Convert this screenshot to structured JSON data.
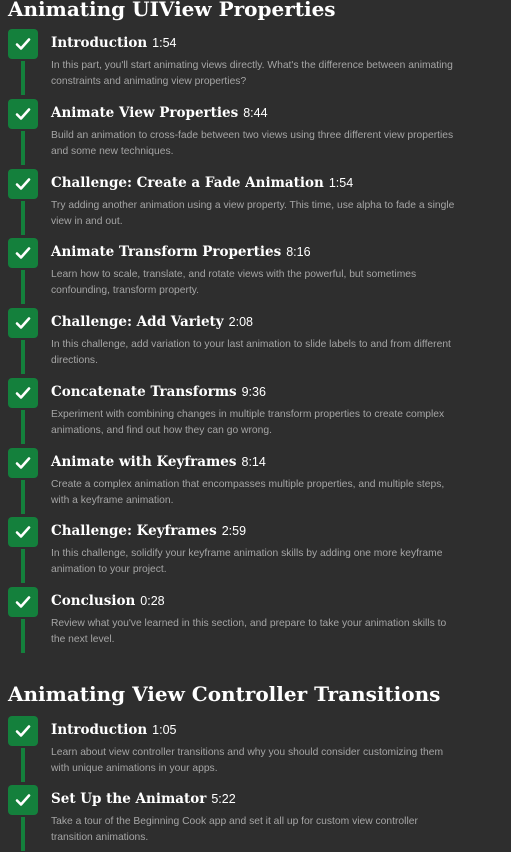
{
  "sections": [
    {
      "title": "Animating UIView Properties",
      "lessons": [
        {
          "title": "Introduction",
          "duration": "1:54",
          "description": "In this part, you'll start animating views directly. What's the difference between animating constraints and animating view properties?",
          "completed": true
        },
        {
          "title": "Animate View Properties",
          "duration": "8:44",
          "description": "Build an animation to cross-fade between two views using three different view properties and some new techniques.",
          "completed": true
        },
        {
          "title": "Challenge: Create a Fade Animation",
          "duration": "1:54",
          "description": "Try adding another animation using a view property. This time, use alpha to fade a single view in and out.",
          "completed": true
        },
        {
          "title": "Animate Transform Properties",
          "duration": "8:16",
          "description": "Learn how to scale, translate, and rotate views with the powerful, but sometimes confounding, transform property.",
          "completed": true
        },
        {
          "title": "Challenge: Add Variety",
          "duration": "2:08",
          "description": "In this challenge, add variation to your last animation to slide labels to and from different directions.",
          "completed": true
        },
        {
          "title": "Concatenate Transforms",
          "duration": "9:36",
          "description": "Experiment with combining changes in multiple transform properties to create complex animations, and find out how they can go wrong.",
          "completed": true
        },
        {
          "title": "Animate with Keyframes",
          "duration": "8:14",
          "description": "Create a complex animation that encompasses multiple properties, and multiple steps, with a keyframe animation.",
          "completed": true
        },
        {
          "title": "Challenge: Keyframes",
          "duration": "2:59",
          "description": "In this challenge, solidify your keyframe animation skills by adding one more keyframe animation to your project.",
          "completed": true
        },
        {
          "title": "Conclusion",
          "duration": "0:28",
          "description": "Review what you've learned in this section, and prepare to take your animation skills to the next level.",
          "completed": true
        }
      ]
    },
    {
      "title": "Animating View Controller Transitions",
      "lessons": [
        {
          "title": "Introduction",
          "duration": "1:05",
          "description": "Learn about view controller transitions and why you should consider customizing them with unique animations in your apps.",
          "completed": true
        },
        {
          "title": "Set Up the Animator",
          "duration": "5:22",
          "description": "Take a tour of the Beginning Cook app and set it all up for custom view controller transition animations.",
          "completed": true
        }
      ]
    }
  ],
  "icon": "checkmark-icon",
  "colors": {
    "background": "#2e2e2e",
    "accent": "#14803c",
    "title": "#ffffff",
    "description": "#a5a5a5"
  }
}
